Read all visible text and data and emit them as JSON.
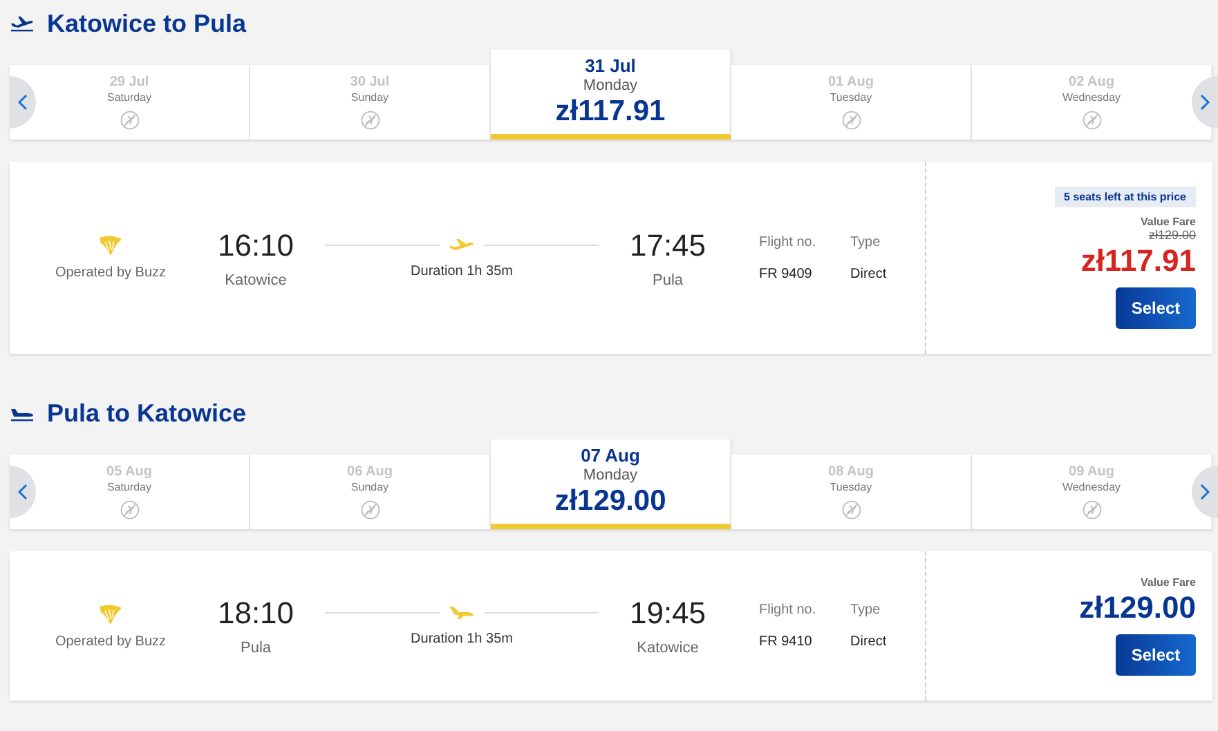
{
  "sections": [
    {
      "title": "Katowice to Pula",
      "kind": "departure",
      "days": [
        {
          "date": "29 Jul",
          "weekday": "Saturday",
          "selected": false
        },
        {
          "date": "30 Jul",
          "weekday": "Sunday",
          "selected": false
        },
        {
          "date": "31 Jul",
          "weekday": "Monday",
          "selected": true,
          "price": "zł117.91"
        },
        {
          "date": "01 Aug",
          "weekday": "Tuesday",
          "selected": false
        },
        {
          "date": "02 Aug",
          "weekday": "Wednesday",
          "selected": false
        }
      ],
      "flight": {
        "operator": "Operated by Buzz",
        "depart_time": "16:10",
        "depart_city": "Katowice",
        "duration": "Duration 1h 35m",
        "arrive_time": "17:45",
        "arrive_city": "Pula",
        "flight_no_label": "Flight no.",
        "flight_no": "FR 9409",
        "type_label": "Type",
        "type": "Direct",
        "seats_badge": "5 seats left at this price",
        "fare_name": "Value Fare",
        "old_price": "zł129.00",
        "price": "zł117.91",
        "discounted": true,
        "button": "Select"
      }
    },
    {
      "title": "Pula to Katowice",
      "kind": "return",
      "days": [
        {
          "date": "05 Aug",
          "weekday": "Saturday",
          "selected": false
        },
        {
          "date": "06 Aug",
          "weekday": "Sunday",
          "selected": false
        },
        {
          "date": "07 Aug",
          "weekday": "Monday",
          "selected": true,
          "price": "zł129.00"
        },
        {
          "date": "08 Aug",
          "weekday": "Tuesday",
          "selected": false
        },
        {
          "date": "09 Aug",
          "weekday": "Wednesday",
          "selected": false
        }
      ],
      "flight": {
        "operator": "Operated by Buzz",
        "depart_time": "18:10",
        "depart_city": "Pula",
        "duration": "Duration 1h 35m",
        "arrive_time": "19:45",
        "arrive_city": "Katowice",
        "flight_no_label": "Flight no.",
        "flight_no": "FR 9410",
        "type_label": "Type",
        "type": "Direct",
        "fare_name": "Value Fare",
        "price": "zł129.00",
        "discounted": false,
        "button": "Select"
      }
    }
  ]
}
